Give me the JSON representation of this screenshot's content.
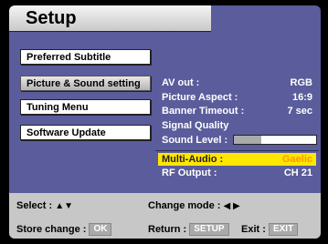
{
  "title": "Setup",
  "menu": {
    "items": [
      {
        "label": "Preferred Subtitle",
        "active": false
      },
      {
        "label": "Picture & Sound setting",
        "active": true
      },
      {
        "label": "Tuning Menu",
        "active": false
      },
      {
        "label": "Software Update",
        "active": false
      }
    ]
  },
  "settings": {
    "av_out": {
      "label": "AV out :",
      "value": "RGB"
    },
    "picture_aspect": {
      "label": "Picture Aspect :",
      "value": "16:9"
    },
    "banner_timeout": {
      "label": "Banner Timeout :",
      "value": "7 sec"
    },
    "signal_quality": {
      "label": "Signal Quality",
      "value": ""
    },
    "sound_level": {
      "label": "Sound Level :",
      "level_fraction": 0.33
    },
    "multi_audio": {
      "label": "Multi-Audio :",
      "value": "Gaelic",
      "highlighted": true
    },
    "rf_output": {
      "label": "RF Output :",
      "value": "CH 21"
    }
  },
  "footer": {
    "select_label": "Select :",
    "select_arrows": "▲▼",
    "change_mode_label": "Change mode :",
    "change_mode_arrows": "◀ ▶",
    "store_label": "Store change :",
    "store_key": "OK",
    "return_label": "Return :",
    "return_key": "SETUP",
    "exit_label": "Exit :",
    "exit_key": "EXIT"
  },
  "colors": {
    "background": "#5a5c9b",
    "highlight": "#ffe600",
    "highlight_value": "#ff9900"
  }
}
